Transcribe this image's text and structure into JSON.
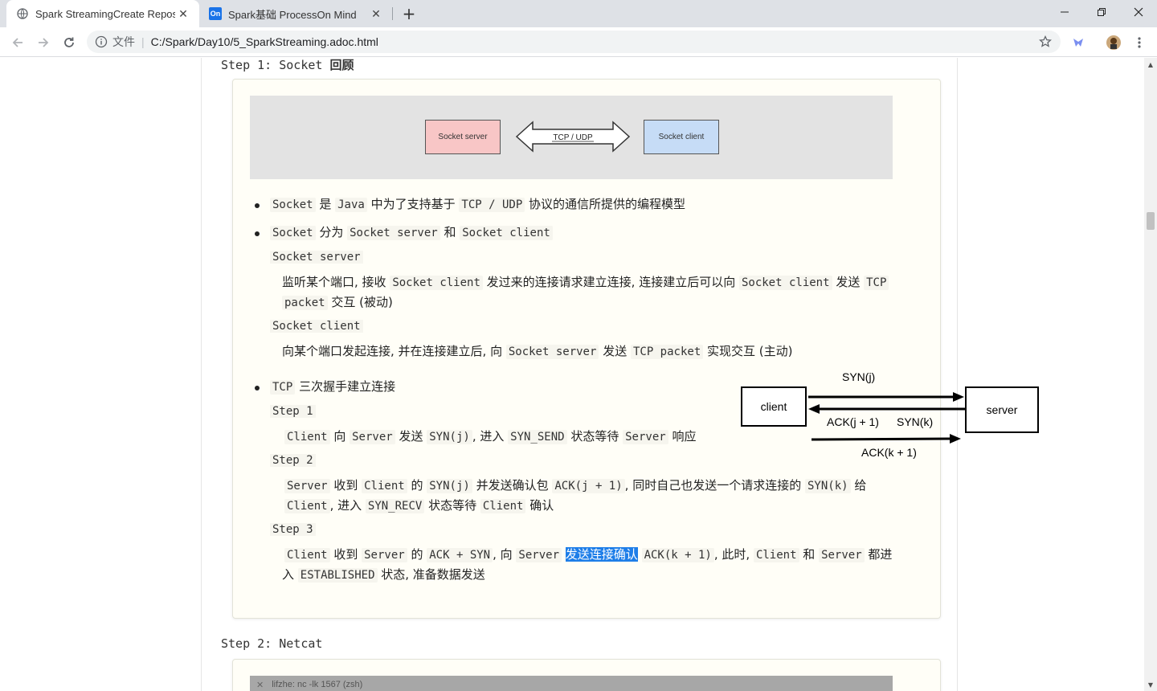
{
  "browser": {
    "tabs": [
      {
        "title": "Spark StreamingCreate Reposi",
        "active": true
      },
      {
        "title": "Spark基础 ProcessOn Mind",
        "active": false
      }
    ],
    "tab2_favicon_text": "On",
    "address": {
      "scheme_label": "文件",
      "url": "C:/Spark/Day10/5_SparkStreaming.adoc.html"
    }
  },
  "doc": {
    "step1": {
      "prefix": "Step 1: Socket ",
      "bold": "回顾"
    },
    "figure": {
      "server": "Socket server",
      "arrow": "TCP / UDP",
      "client": "Socket client"
    },
    "b1": {
      "c1": "Socket",
      "t1": " 是 ",
      "c2": "Java",
      "t2": " 中为了支持基于 ",
      "c3": "TCP / UDP",
      "t3": " 协议的通信所提供的编程模型"
    },
    "b2": {
      "c1": "Socket",
      "t1": " 分为 ",
      "c2": "Socket server",
      "t2": " 和 ",
      "c3": "Socket client"
    },
    "dt_server": "Socket server",
    "dd_server_l1": {
      "t1": "监听某个端口, 接收 ",
      "c1": "Socket client",
      "t2": " 发过来的连接请求建立连接, 连接建立后可以向 ",
      "c2": "Socket client",
      "t3": " 发送 ",
      "c3": "TCP"
    },
    "dd_server_l2": {
      "c1": "packet",
      "t1": " 交互 (被动)"
    },
    "dt_client": "Socket client",
    "dd_client": {
      "t1": "向某个端口发起连接, 并在连接建立后, 向 ",
      "c1": "Socket server",
      "t2": " 发送 ",
      "c2": "TCP packet",
      "t3": " 实现交互 (主动)"
    },
    "b3": {
      "c1": "TCP",
      "t1": " 三次握手建立连接"
    },
    "s1": {
      "dt": "Step 1",
      "c1": "Client",
      "t1": " 向 ",
      "c2": "Server",
      "t2": " 发送 ",
      "c3": "SYN(j)",
      "t3": ", 进入 ",
      "c4": "SYN_SEND",
      "t4": " 状态等待 ",
      "c5": "Server",
      "t5": " 响应"
    },
    "s2": {
      "dt": "Step 2",
      "c1": "Server",
      "t1": " 收到 ",
      "c2": "Client",
      "t2": " 的 ",
      "c3": "SYN(j)",
      "t3": " 并发送确认包 ",
      "c4": "ACK(j + 1)",
      "t4": ", 同时自己也发送一个请求连接的 ",
      "c5": "SYN(k)",
      "t5": " 给",
      "l2c1": "Client",
      "l2t1": ", 进入 ",
      "l2c2": "SYN_RECV",
      "l2t2": " 状态等待 ",
      "l2c3": "Client",
      "l2t3": " 确认"
    },
    "s3": {
      "dt": "Step 3",
      "c1": "Client",
      "t1": " 收到 ",
      "c2": "Server",
      "t2": " 的 ",
      "c3": "ACK + SYN",
      "t3": ", 向 ",
      "c4": "Server",
      "hl": "发送连接确认",
      "c5": "ACK(k + 1)",
      "t5": ", 此时, ",
      "c6": "Client",
      "t6": " 和 ",
      "c7": "Server",
      "t7": " 都进",
      "l2t1": "入 ",
      "l2c1": "ESTABLISHED",
      "l2t2": " 状态, 准备数据发送"
    },
    "handshake": {
      "client": "client",
      "server": "server",
      "syn_j": "SYN(j)",
      "ack_j1": "ACK(j + 1)",
      "syn_k": "SYN(k)",
      "ack_k1": "ACK(k + 1)"
    },
    "step2": {
      "prefix": "Step 2: ",
      "name": "Netcat"
    },
    "terminal_title": "lifzhe: nc -lk 1567 (zsh)"
  }
}
